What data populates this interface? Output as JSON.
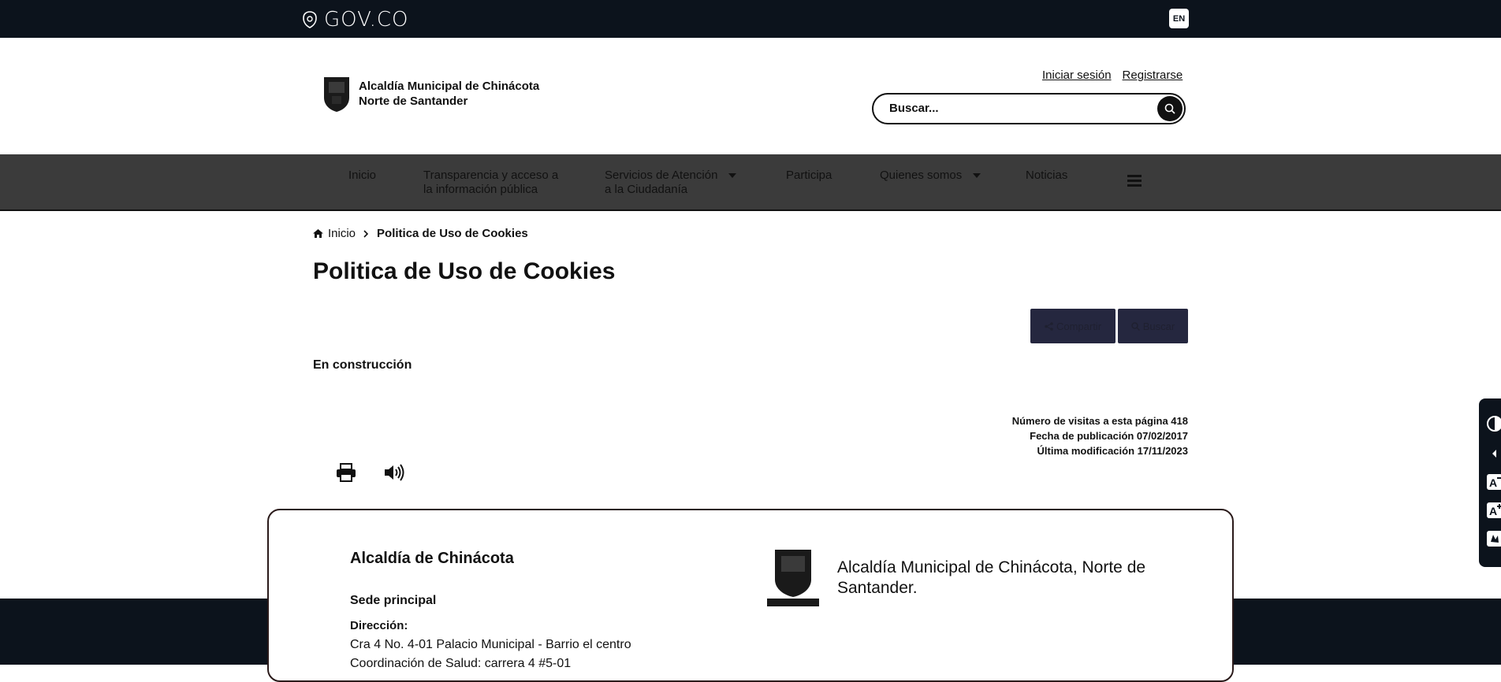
{
  "gov_bar": {
    "logo_text": "GOV.CO",
    "lang_button": "EN"
  },
  "header": {
    "brand_line1": "Alcaldía Municipal de Chinácota",
    "brand_line2": "Norte de Santander",
    "login_link": "Iniciar sesión",
    "register_link": "Registrarse",
    "search_placeholder": "Buscar..."
  },
  "nav": {
    "items": [
      {
        "line1": "Inicio",
        "line2": ""
      },
      {
        "line1": "Transparencia y acceso a",
        "line2": "la información pública"
      },
      {
        "line1": "Servicios de Atención",
        "line2": "a la Ciudadanía"
      },
      {
        "line1": "Participa",
        "line2": ""
      },
      {
        "line1": "Quienes somos",
        "line2": ""
      },
      {
        "line1": "Noticias",
        "line2": ""
      }
    ]
  },
  "breadcrumb": {
    "home": "Inicio",
    "current": "Politica de Uso de Cookies"
  },
  "page": {
    "title": "Politica de Uso de Cookies",
    "share_label": "Compartir",
    "search_label": "Buscar",
    "body_text": "En construcción",
    "visits": "Número de visitas a esta página 418",
    "published": "Fecha de publicación 07/02/2017",
    "modified": "Última modificación 17/11/2023"
  },
  "footer": {
    "title": "Alcaldía de Chinácota",
    "sede": "Sede principal",
    "direccion_label": "Dirección:",
    "direccion": "Cra 4 No. 4-01 Palacio Municipal - Barrio el centro",
    "coordinacion": "Coordinación de Salud: carrera 4 #5-01",
    "org_name": "Alcaldía Municipal de Chinácota, Norte de Santander."
  },
  "colors": {
    "top_bar": "#0c131c",
    "nav_bg": "#3b3b3b",
    "button_bg": "#25273f"
  }
}
